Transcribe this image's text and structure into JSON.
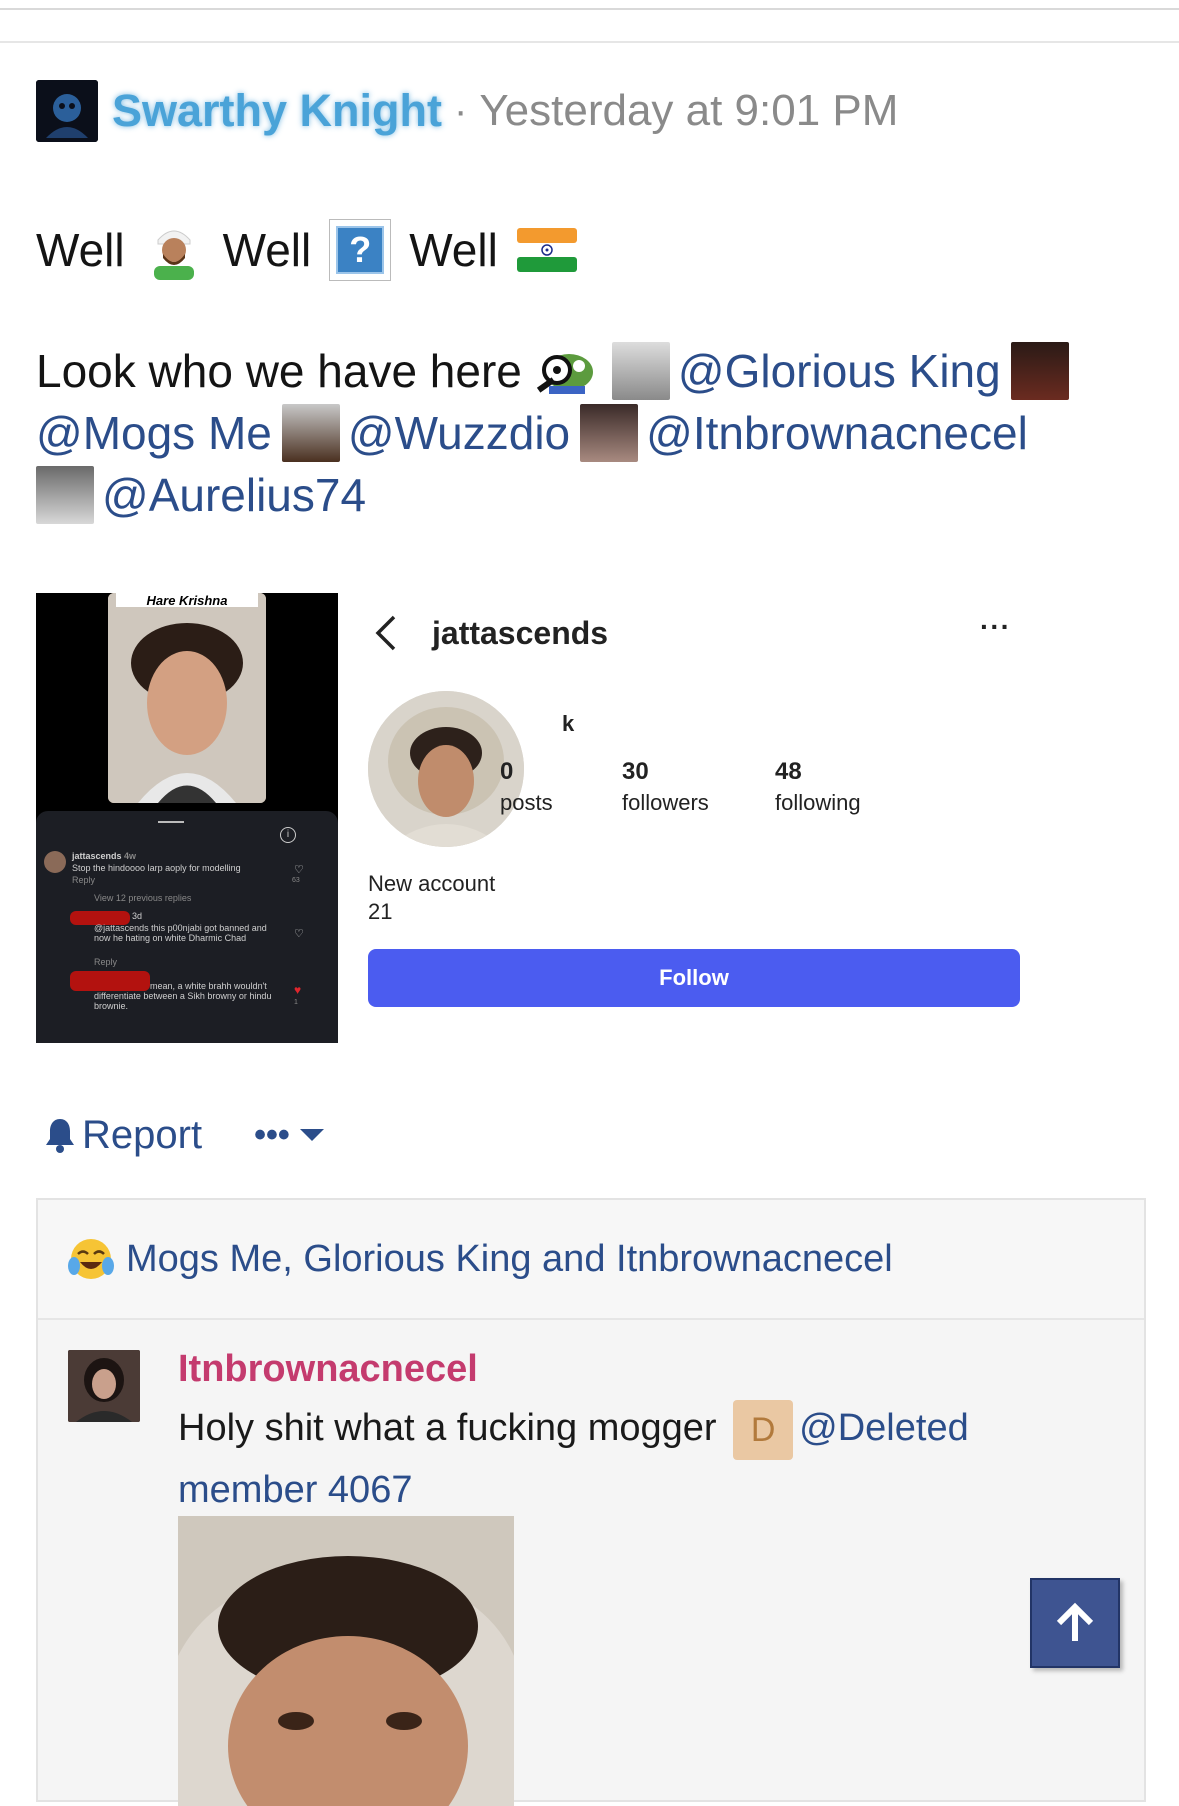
{
  "post": {
    "author": "Swarthy Knight",
    "separator": "·",
    "timestamp": "Yesterday at 9:01 PM",
    "line1": [
      "Well",
      "Well",
      "Well"
    ],
    "line2_prefix": "Look who we have here",
    "mentions": [
      "@Glorious King",
      "@Mogs Me",
      "@Wuzzdio",
      "@Itnbrownacnecel",
      "@Aurelius74"
    ]
  },
  "screenshot_left": {
    "label": "Hare Krishna",
    "comment_user": "jattascends",
    "comment_time": "4w",
    "comment_text": "Stop the hindoooo larp aoply for modelling",
    "reply": "Reply",
    "view_replies": "View 12 previous replies",
    "reply1_time": "3d",
    "reply1_text_a": "@jattascends this p00njabi got banned and",
    "reply1_text_b": "now he hating on white Dharmic Chad",
    "reply2_text_a": "mean, a white brahh wouldn't",
    "reply2_text_b": "differentiate between a Sikh browny or hindu",
    "reply2_text_c": "brownie.",
    "like1": "63",
    "like3": "1"
  },
  "screenshot_right": {
    "username": "jattascends",
    "name": "k",
    "posts_count": "0",
    "posts_label": "posts",
    "followers_count": "30",
    "followers_label": "followers",
    "following_count": "48",
    "following_label": "following",
    "bio_line1": "New account",
    "bio_line2": "21",
    "follow_label": "Follow"
  },
  "actions": {
    "report_label": "Report",
    "more_label": "•••"
  },
  "reactions": {
    "text": "Mogs Me, Glorious King and Itnbrownacnecel"
  },
  "comment": {
    "user": "Itnbrownacnecel",
    "text": "Holy shit what a fucking mogger",
    "badge_letter": "D",
    "mention": "@Deleted member 4067"
  },
  "colors": {
    "link": "#2b4d8a",
    "author_glow": "#4aa3d8",
    "comment_user": "#c43b6e",
    "follow_button": "#4b5cf0",
    "scroll_top": "#3e5491"
  }
}
